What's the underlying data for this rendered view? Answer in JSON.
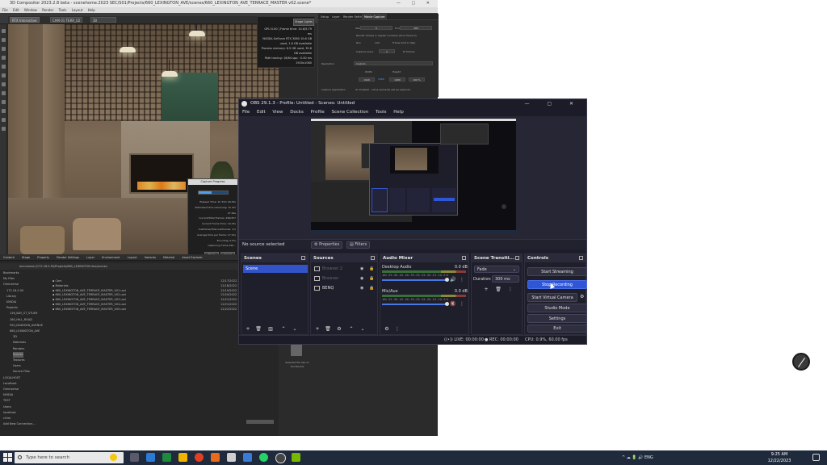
{
  "background_app": {
    "title": "3D Compositor 2023.2.8 beta - scenehome.2023 SEC/S01/Projects/660_LEXINGTON_AVE/scenes/660_LEXINGTON_AVE_TERRACE_MASTER v02.scene*",
    "window_controls": "— ▢ ✕",
    "menu": [
      "File",
      "Edit",
      "Window",
      "Render",
      "Tools",
      "Layout",
      "Help"
    ],
    "toolbar": {
      "viewport_label": "RTX Interactive",
      "camera_label": "CAM 01 TERR_02",
      "fps_label": "30"
    },
    "stats_lines": [
      "GPU 0.00 | Frame time: 14.6/5.79 ms",
      "NVIDIA GeForce RTX 3080 10.6 GB used, 1.6 GB available",
      "Process memory: 8.5 GB used, 39.6 GB available",
      "Path tracing: 16/64 spp : 0.00 ms",
      "1920x1080"
    ],
    "stats_button": "Stage Lights",
    "render_tabs": [
      "Setup",
      "Layer",
      "Render Settings",
      "Movie Capture"
    ],
    "render_fields": {
      "start_label": "Start",
      "start_value": "0",
      "end_label": "End",
      "end_value": "480",
      "opt1": "Render frames in regular numbers (from frame 0)",
      "opt2": "Run",
      "opt2_value": "144",
      "opt3": "Frame limit in (fps)",
      "capture_every_label": "Capture every",
      "capture_every_value": "2",
      "capture_every_unit": "th frames",
      "resolution_label": "Resolution",
      "resolution_value": "Custom",
      "width_label": "Width",
      "height_label": "Height",
      "w_value": "1920",
      "mid_value": "1080",
      "h_value": "1080",
      "percent_value": "100 %",
      "capture_app_label": "Capture Application",
      "capture_app_value": "UI: Enabled - some elements will be captured"
    },
    "progress": {
      "title": "Capture Progress",
      "lines": [
        "Elapsed Time: 1h 33m 49.93s",
        "Estimated time remaining: 1h 9m 27.49s",
        "Current/Total Frames: 296/457",
        "Current Frame Time: 19.23s",
        "Subframe/Total subframes: 1/1",
        "Average time per frame: 17.21s",
        "Encoding: 0.0%",
        "Capturing Frame 296..."
      ],
      "progress_value": 0.45,
      "pause_label": "Pause",
      "cancel_label": "Cancel"
    },
    "lower_tabs": [
      "Content",
      "Stage",
      "Property",
      "Render Settings",
      "Layer",
      "Environment",
      "Layout",
      "Variants",
      "Material",
      "Asset Explorer"
    ],
    "path": "omniverse://172.16.0.50/Projects/660_LEXINGTON Ave/scenes",
    "tree": [
      "Bookmarks",
      "My Files",
      "Omniverse",
      "172.16.0.50",
      "Library",
      "NVIDIA",
      "Projects",
      "126_BAY_ST_STUDY",
      "160_HILL_ROAD",
      "550_MADISON_AVENUE",
      "660_LEXINGTON_AVE",
      "3D",
      "Materials",
      "Renders",
      "Scenes",
      "Textures",
      "Users",
      "Source Files",
      "LOCALHOST",
      "Localhost",
      "Omniverse",
      "NVIDIA",
      "TEST",
      "Users",
      "localhost",
      "cOrm",
      "Add New Connection..."
    ],
    "files": [
      {
        "name": "Cam",
        "date": "12/17/2022 12:57PM"
      },
      {
        "name": "Materials",
        "date": "12/18/2022 12:57PM"
      },
      {
        "name": "660_LEXINGTON_AVE_TERRACE_MASTER_V01.usd",
        "date": "12/19/2022 12:57PM"
      },
      {
        "name": "660_LEXINGTON_AVE_TERRACE_MASTER_V02.usd",
        "date": "12/20/2022 12:57PM"
      },
      {
        "name": "660_LEXINGTON_AVE_TERRACE_MASTER_V03.usd",
        "date": "12/21/2022 12:57PM"
      },
      {
        "name": "660_LEXINGTON_AVE_TERRACE_MASTER_V04.usd",
        "date": "12/21/2022 12:57PM"
      },
      {
        "name": "660_LEXINGTON_AVE_TERRACE_MASTER_V05.usd",
        "date": "12/22/2022 12:57PM"
      }
    ],
    "selected_file_label": "Selected file has no thumbnails"
  },
  "obs": {
    "title": "OBS 29.1.3 - Profile: Untitled - Scenes: Untitled",
    "window_controls": "—  ▢  ✕",
    "menu": [
      "File",
      "Edit",
      "View",
      "Docks",
      "Profile",
      "Scene Collection",
      "Tools",
      "Help"
    ],
    "no_source": "No source selected",
    "properties_label": "Properties",
    "filters_label": "Filters",
    "docks": {
      "scenes": "Scenes",
      "sources": "Sources",
      "mixer": "Audio Mixer",
      "transitions": "Scene Transiti...",
      "controls": "Controls"
    },
    "scene_items": [
      "Scene"
    ],
    "sources": [
      {
        "name": "Browser 2",
        "dim": true
      },
      {
        "name": "Browser",
        "dim": true
      },
      {
        "name": "BENQ",
        "dim": false
      }
    ],
    "mixer": [
      {
        "name": "Desktop Audio",
        "db": "0.0 dB"
      },
      {
        "name": "Mic/Aux",
        "db": "0.0 dB"
      }
    ],
    "meter_ticks": "-60 -55 -50 -45 -40 -35 -30 -25 -20 -15 -10 -5 0",
    "transition": {
      "type": "Fade",
      "duration_label": "Duration",
      "duration_value": "300 ms"
    },
    "controls": [
      "Start Streaming",
      "Stop Recording",
      "Start Virtual Camera",
      "Studio Mode",
      "Settings",
      "Exit"
    ],
    "active_control": "Stop Recording",
    "status": {
      "live": "LIVE: 00:00:00",
      "rec": "REC: 00:00:00",
      "cpu": "CPU: 0.9%, 60.00 fps"
    }
  },
  "taskbar": {
    "search_placeholder": "Type here to search",
    "tray": "^  ☁  🔋  🔊  ENG",
    "time": "9:25 AM",
    "date": "12/22/2023"
  },
  "colors": {
    "accent": "#2f56d6",
    "scene_selected": "#3354c8",
    "taskbar": "#1f2a3c"
  }
}
